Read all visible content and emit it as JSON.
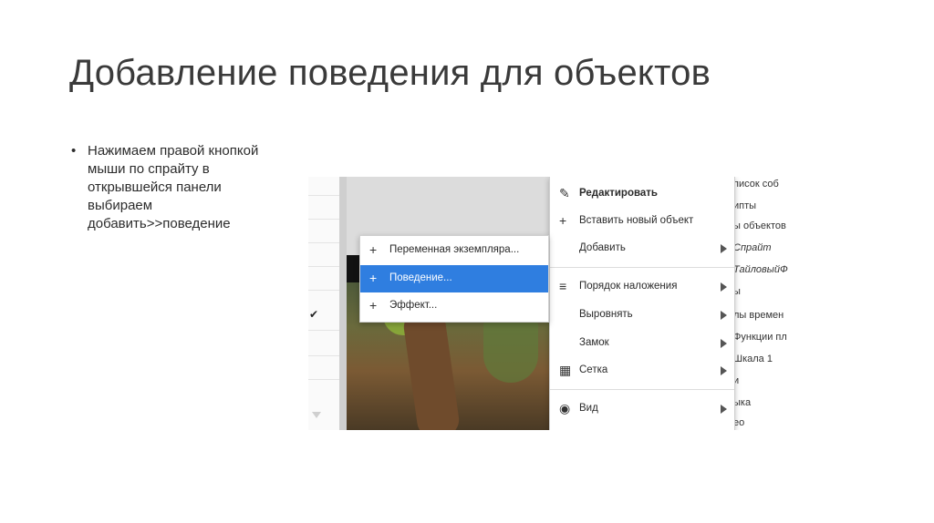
{
  "slide": {
    "title": "Добавление поведения для объектов",
    "bullet_text": "Нажимаем правой кнопкой мыши по спрайту в открывшейся панели выбираем добавить>>поведение"
  },
  "context_menu": {
    "items": [
      {
        "label": "Редактировать",
        "icon": "pencil-icon"
      },
      {
        "label": "Вставить новый объект",
        "icon": "plus-icon"
      },
      {
        "label": "Добавить",
        "icon": ""
      },
      {
        "label": "Порядок наложения",
        "icon": "list-icon"
      },
      {
        "label": "Выровнять",
        "icon": ""
      },
      {
        "label": "Замок",
        "icon": ""
      },
      {
        "label": "Сетка",
        "icon": "grid-icon"
      },
      {
        "label": "Вид",
        "icon": "eye-icon"
      }
    ]
  },
  "submenu": {
    "items": [
      {
        "label": "Переменная экземпляра...",
        "icon": "plus-icon"
      },
      {
        "label": "Поведение...",
        "icon": "plus-icon",
        "selected": true
      },
      {
        "label": "Эффект...",
        "icon": "plus-icon"
      }
    ]
  },
  "right_panel": {
    "items": [
      "писок соб",
      "ипты",
      "ы объектов",
      "Спрайт",
      "ТайловыйФ",
      "ы",
      "лы времен",
      "Функции пл",
      "Шкала 1",
      "и",
      "ыка",
      "ео"
    ]
  },
  "colors": {
    "selection": "#2f7ee0",
    "title_text": "#3a3a3a"
  }
}
